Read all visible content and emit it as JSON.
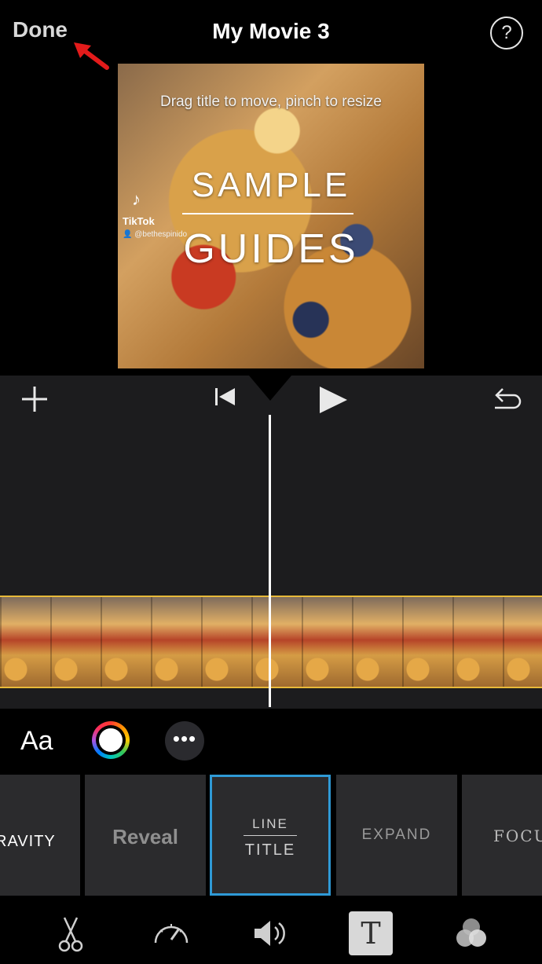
{
  "header": {
    "done_label": "Done",
    "title": "My Movie 3",
    "help_label": "?"
  },
  "preview": {
    "hint": "Drag title to move, pinch to resize",
    "title_line1": "SAMPLE",
    "title_line2": "GUIDES",
    "watermark": {
      "logo": "♪",
      "name": "TikTok",
      "handle": "👤 @bethespinido"
    }
  },
  "timeline": {
    "icons": [
      "plus-icon",
      "rewind-icon",
      "play-icon",
      "undo-icon"
    ]
  },
  "format_row": {
    "font_label": "Aa",
    "more_label": "•••"
  },
  "title_styles": [
    {
      "label": "RAVITY"
    },
    {
      "label": "Reveal"
    },
    {
      "label_top": "LINE",
      "label_bottom": "TITLE",
      "selected": true
    },
    {
      "label": "EXPAND"
    },
    {
      "label": "FOCU"
    }
  ],
  "toolbar": {
    "titles_label": "T",
    "icons": [
      "scissors-icon",
      "speed-icon",
      "volume-icon",
      "titles-icon",
      "filters-icon"
    ]
  },
  "colors": {
    "selected_border": "#2f9ad6",
    "clip_border": "#e7b93a",
    "annotation_arrow": "#e31b1b"
  }
}
